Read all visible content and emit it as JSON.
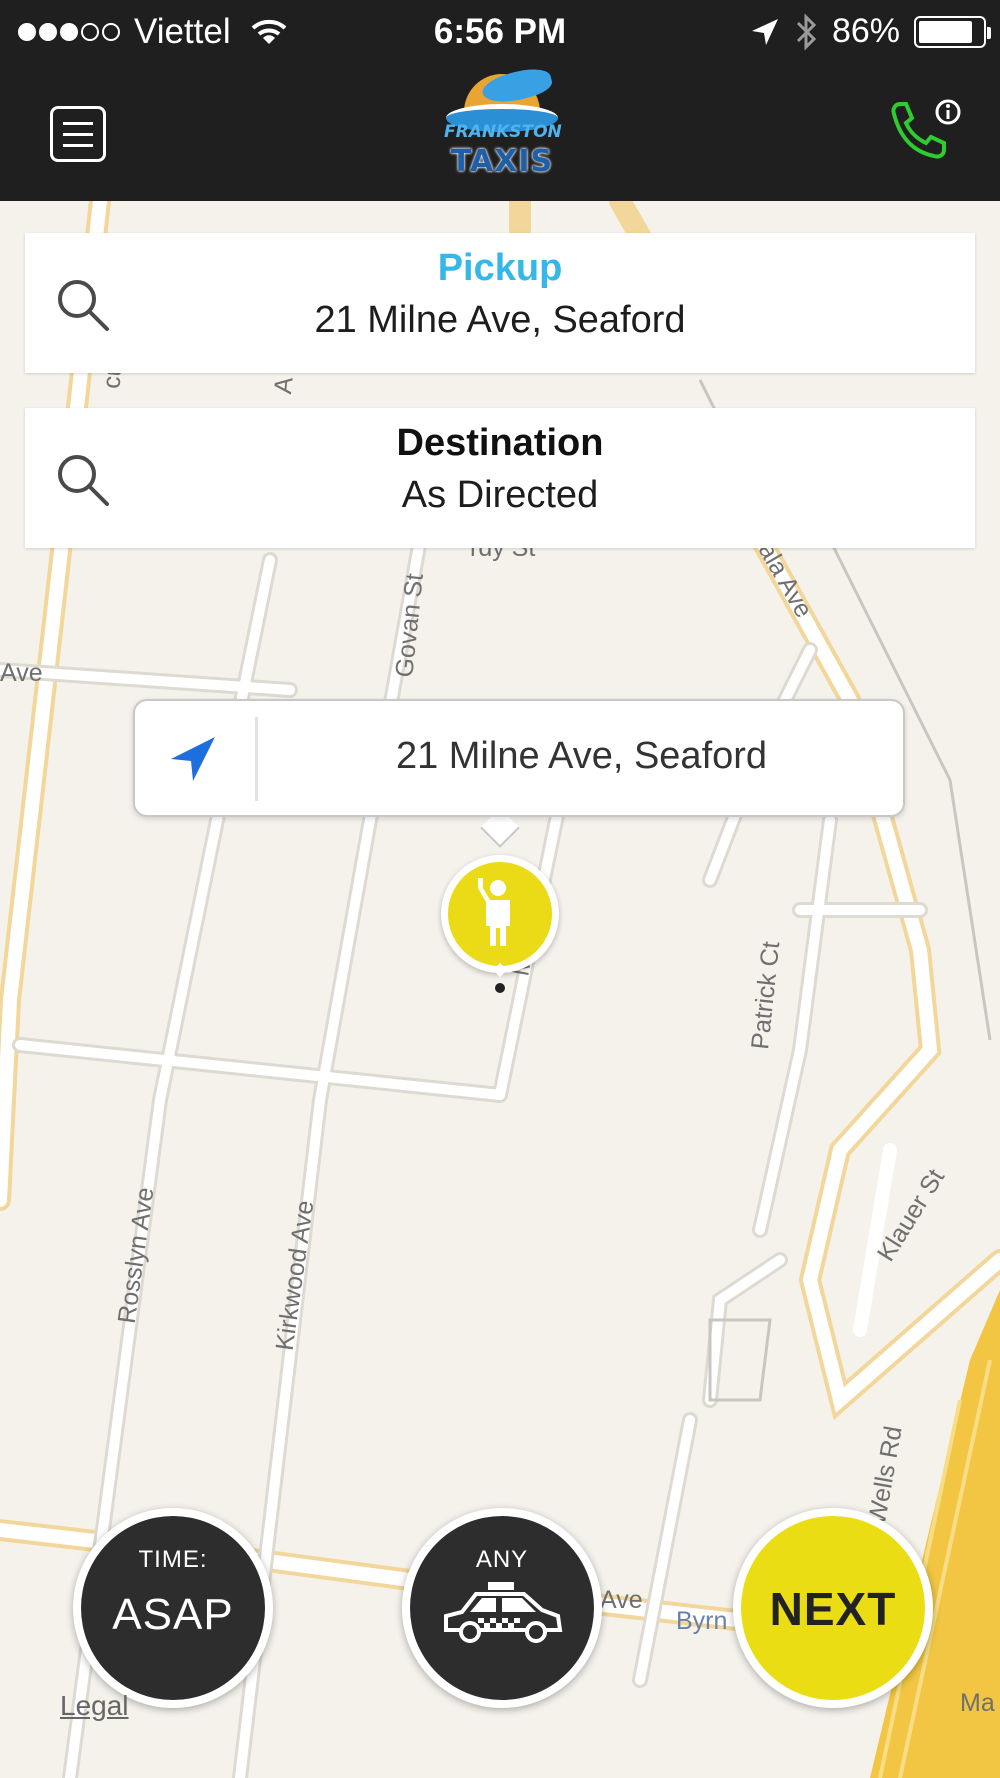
{
  "status_bar": {
    "carrier": "Viettel",
    "time": "6:56 PM",
    "battery": "86%",
    "battery_level": 0.86,
    "signal_bars_filled": 3,
    "signal_bars_total": 5
  },
  "nav": {
    "logo_line1": "FRANKSTON",
    "logo_line2": "TAXIS",
    "call_icon_color": "#2ecc2e"
  },
  "pickup": {
    "title": "Pickup",
    "address": "21 Milne Ave, Seaford",
    "title_color": "#35b7e8"
  },
  "destination": {
    "title": "Destination",
    "address": "As Directed"
  },
  "callout": {
    "address": "21 Milne Ave, Seaford"
  },
  "map": {
    "streets": {
      "cu": "cu",
      "a": "A",
      "rdy": "rdy St",
      "ala": "ala Ave",
      "ave_left": "Ave",
      "govan": "Govan St",
      "patrick": "Patrick Ct",
      "rosslyn": "Rosslyn Ave",
      "kirkwood": "Kirkwood Ave",
      "klauer": "Klauer St",
      "wells": "Wells Rd",
      "ave_bottom": "Ave",
      "byrn": "Byrn",
      "ma": "Ma",
      "m": "M"
    }
  },
  "buttons": {
    "time_label": "TIME:",
    "time_value": "ASAP",
    "vehicle_label": "ANY",
    "next": "NEXT"
  },
  "legal": "Legal",
  "colors": {
    "bar_bg": "#1f1f1f",
    "accent_yellow": "#eadd13",
    "map_bg": "#f5f2ec"
  }
}
